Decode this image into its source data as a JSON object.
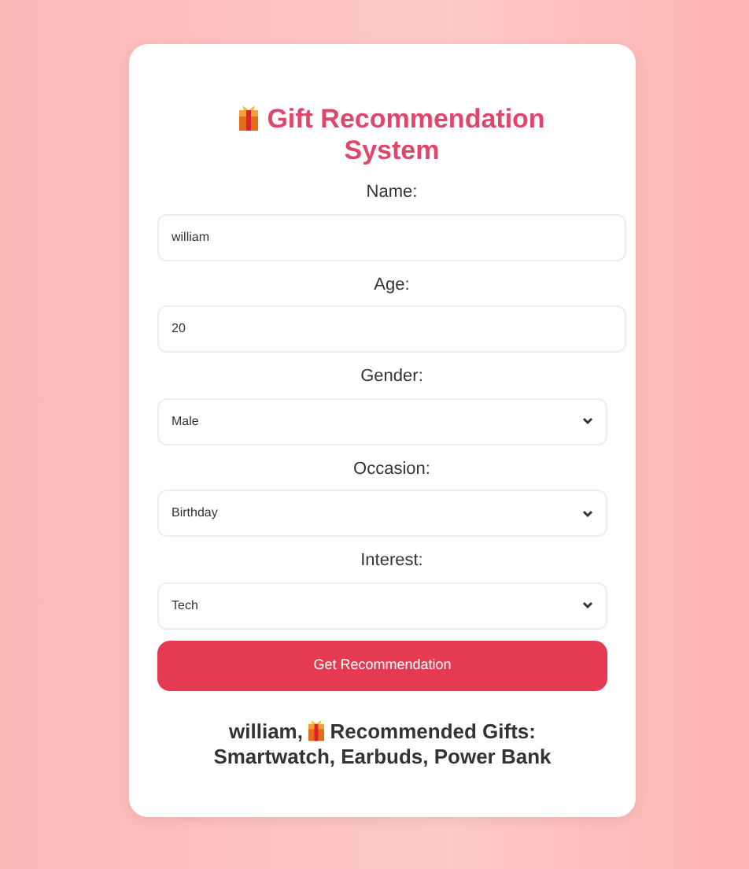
{
  "title": {
    "line1": "Gift Recommendation",
    "line2": "System"
  },
  "fields": [
    {
      "kind": "input",
      "label": "Name:",
      "value": "william"
    },
    {
      "kind": "input",
      "label": "Age:",
      "value": "20"
    },
    {
      "kind": "select",
      "label": "Gender:",
      "value": "Male"
    },
    {
      "kind": "select",
      "label": "Occasion:",
      "value": "Birthday"
    },
    {
      "kind": "select",
      "label": "Interest:",
      "value": "Tech"
    }
  ],
  "button": "Get Recommendation",
  "result": {
    "name": "william,",
    "heading": "Recommended Gifts:",
    "gifts": "Smartwatch, Earbuds, Power Bank"
  }
}
